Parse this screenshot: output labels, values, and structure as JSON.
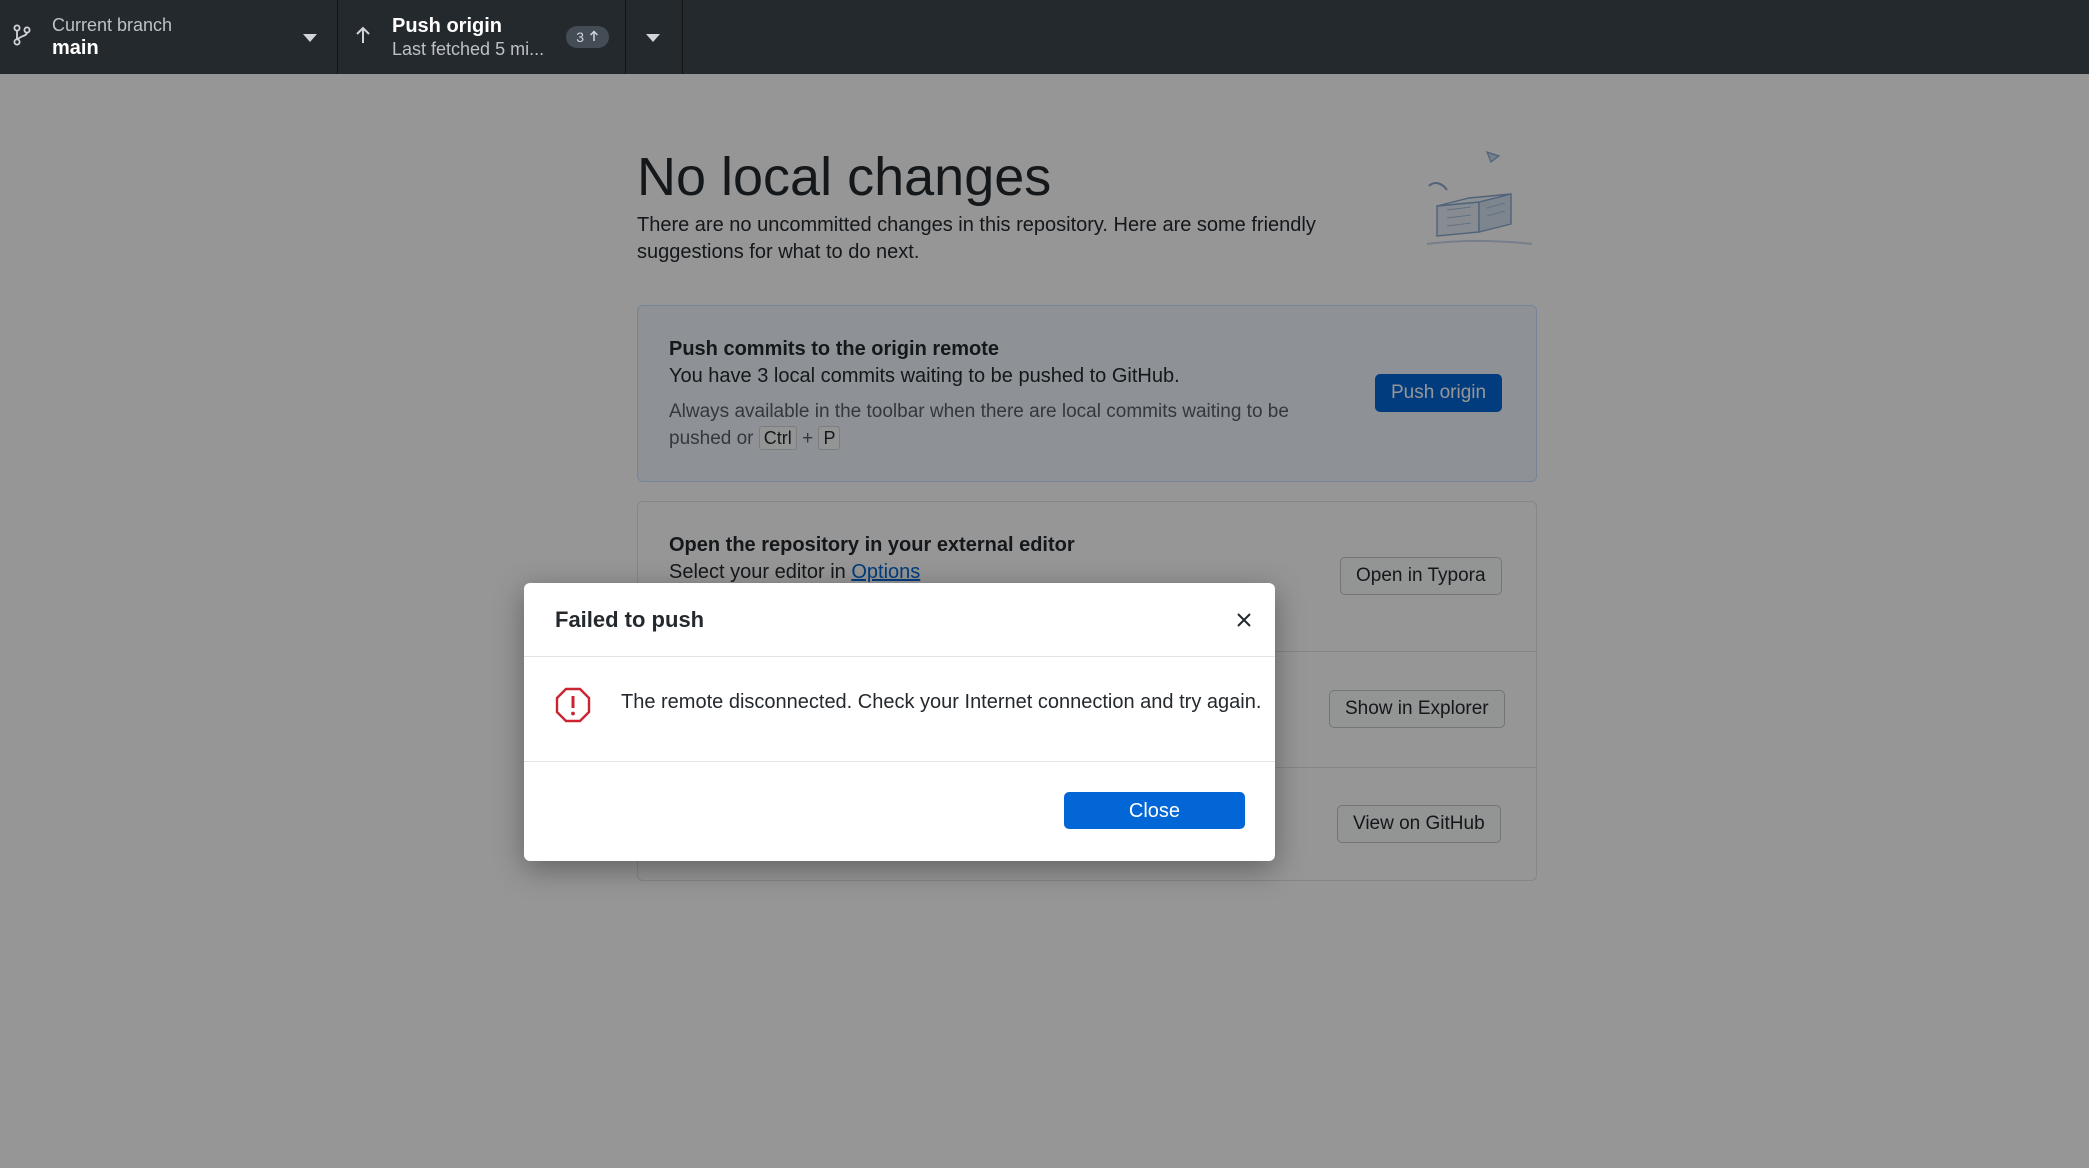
{
  "toolbar": {
    "branch": {
      "label": "Current branch",
      "value": "main"
    },
    "push": {
      "title": "Push origin",
      "subtitle": "Last fetched 5 mi...",
      "badge_count": "3"
    }
  },
  "main": {
    "title": "No local changes",
    "subtitle": "There are no uncommitted changes in this repository. Here are some friendly suggestions for what to do next.",
    "push_card": {
      "title": "Push commits to the origin remote",
      "text": "You have 3 local commits waiting to be pushed to GitHub.",
      "hint_prefix": "Always available in the toolbar when there are local commits waiting to be pushed or",
      "kbd_ctrl": "Ctrl",
      "kbd_plus": "+",
      "kbd_p": "P",
      "button": "Push origin"
    },
    "editor_card": {
      "title": "Open the repository in your external editor",
      "text_prefix": "Select your editor in",
      "link": "Options",
      "button": "Open in Typora"
    },
    "explorer_card": {
      "button": "Show in Explorer"
    },
    "github_card": {
      "button": "View on GitHub"
    }
  },
  "dialog": {
    "title": "Failed to push",
    "message": "The remote disconnected. Check your Internet connection and try again.",
    "close_button": "Close"
  },
  "colors": {
    "toolbar_bg": "#24292e",
    "primary_blue": "#0366d6",
    "error_red": "#cb2431",
    "overlay": "rgba(0,0,0,0.41)"
  }
}
